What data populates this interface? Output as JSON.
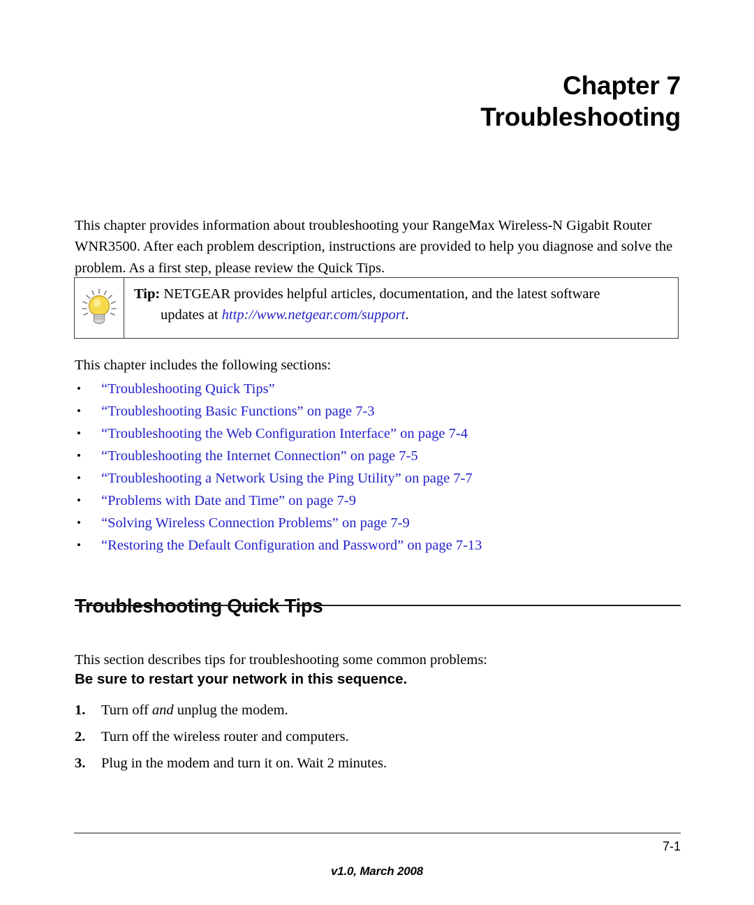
{
  "chapter": {
    "line1": "Chapter 7",
    "line2": "Troubleshooting"
  },
  "intro": {
    "paragraph": "This chapter provides information about troubleshooting your RangeMax Wireless-N Gigabit Router WNR3500. After each problem description, instructions are provided to help you diagnose and solve the problem. As a first step, please review the Quick Tips."
  },
  "tip": {
    "icon": "lightbulb-icon",
    "label": "Tip:",
    "text": " NETGEAR provides helpful articles, documentation, and the latest software",
    "line2_prefix": "updates at ",
    "url": "http://www.netgear.com/support",
    "line2_suffix": ".",
    "link_color": "#2222cc"
  },
  "sections": {
    "intro_line": "This chapter includes the following sections:",
    "bullet_glyph": "•",
    "items": [
      {
        "label": "“Troubleshooting Quick Tips”"
      },
      {
        "label": "“Troubleshooting Basic Functions” on page 7-3"
      },
      {
        "label": "“Troubleshooting the Web Configuration Interface” on page 7-4"
      },
      {
        "label": "“Troubleshooting the Internet Connection” on page 7-5"
      },
      {
        "label": "“Troubleshooting a Network Using the Ping Utility” on page 7-7"
      },
      {
        "label": "“Problems with Date and Time” on page 7-9"
      },
      {
        "label": "“Solving Wireless Connection Problems” on page 7-9"
      },
      {
        "label": "“Restoring the Default Configuration and Password” on page 7-13"
      }
    ]
  },
  "quick_tips": {
    "heading": "Troubleshooting Quick Tips",
    "intro": "This section describes tips for troubleshooting some common problems:",
    "sub_heading": "Be sure to restart your network in this sequence.",
    "steps": [
      {
        "num": "1.",
        "pre": "Turn off ",
        "em": "and",
        "post": " unplug the modem."
      },
      {
        "num": "2.",
        "pre": "Turn off the wireless router and computers.",
        "em": "",
        "post": ""
      },
      {
        "num": "3.",
        "pre": "Plug in the modem and turn it on. Wait 2 minutes.",
        "em": "",
        "post": ""
      }
    ]
  },
  "footer": {
    "page_number": "7-1",
    "version": "v1.0, March 2008"
  }
}
